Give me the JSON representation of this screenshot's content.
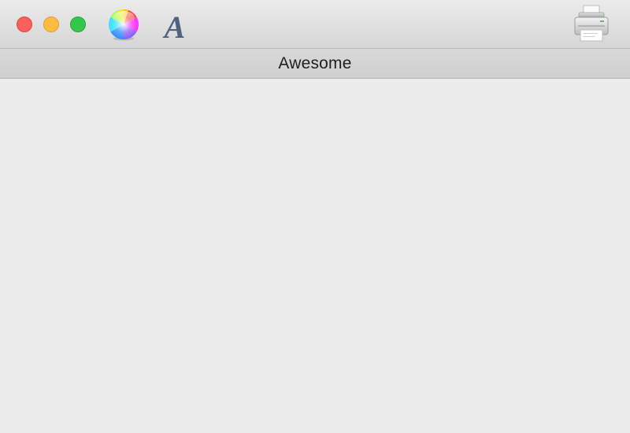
{
  "window": {
    "title": "Awesome"
  },
  "traffic_lights": {
    "close_color": "#fc605c",
    "minimize_color": "#fdbc40",
    "zoom_color": "#34c84a"
  },
  "toolbar": {
    "items": [
      {
        "icon": "color-wheel-icon"
      },
      {
        "icon": "font-icon",
        "glyph": "A"
      },
      {
        "icon": "printer-icon"
      }
    ]
  }
}
